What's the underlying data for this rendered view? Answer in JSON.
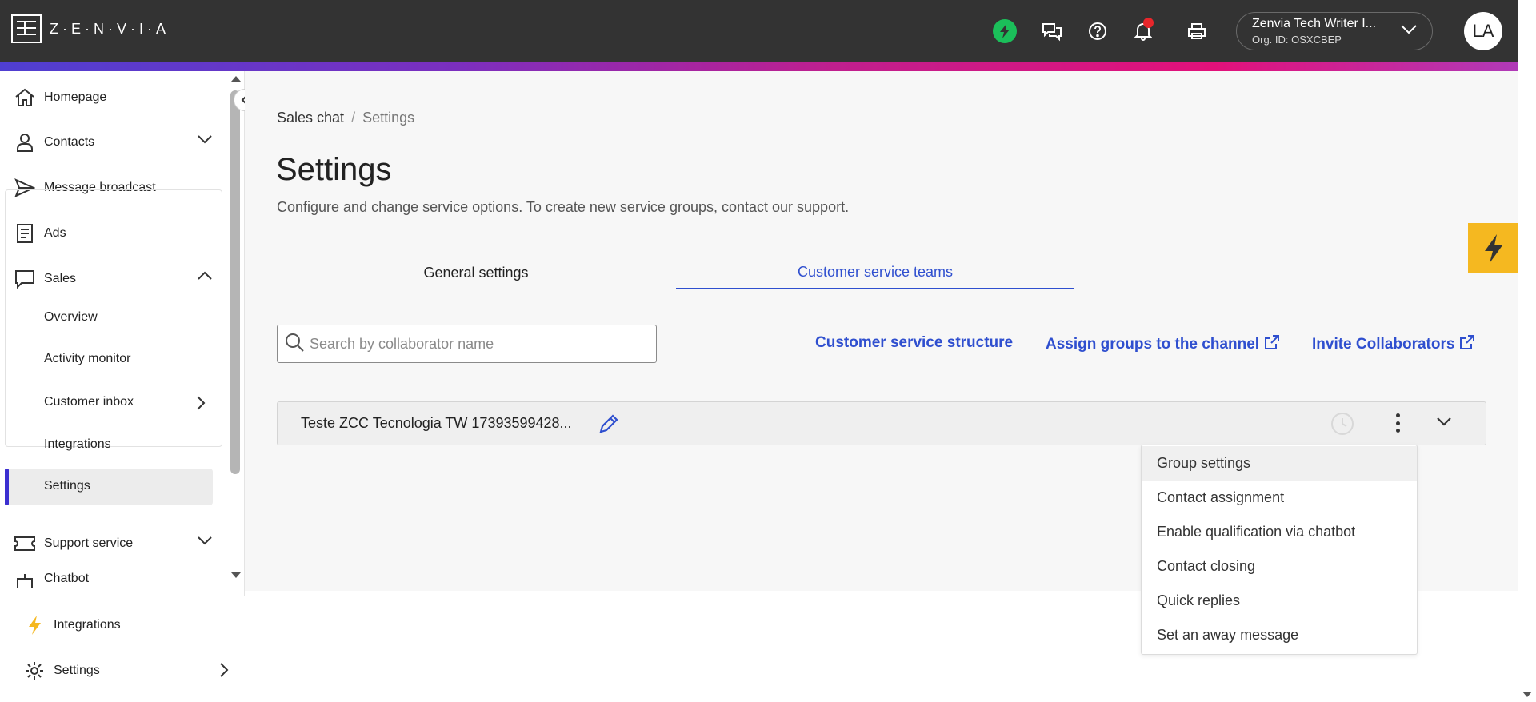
{
  "brand": {
    "logo_text": "Z·E·N·V·I·A"
  },
  "header": {
    "org_name": "Zenvia Tech Writer I...",
    "org_id": "Org. ID: OSXCBEP",
    "avatar_initials": "LA"
  },
  "sidebar": {
    "items": [
      {
        "label": "Homepage",
        "icon": "home-icon"
      },
      {
        "label": "Contacts",
        "icon": "user-icon"
      },
      {
        "label": "Message broadcast",
        "icon": "send-icon"
      },
      {
        "label": "Ads",
        "icon": "document-icon"
      },
      {
        "label": "Sales",
        "icon": "chat-icon"
      }
    ],
    "sales_sub": [
      "Overview",
      "Activity monitor",
      "Customer inbox",
      "Integrations",
      "Settings"
    ],
    "more_items": [
      {
        "label": "Support service",
        "icon": "ticket-icon"
      },
      {
        "label": "Chatbot",
        "icon": "bot-icon"
      }
    ],
    "footer": [
      {
        "label": "Integrations",
        "icon": "bolt-icon"
      },
      {
        "label": "Settings",
        "icon": "gear-icon"
      }
    ]
  },
  "main": {
    "breadcrumb": [
      "Sales chat",
      "Settings"
    ],
    "breadcrumb_sep": "/",
    "title": "Settings",
    "description": "Configure and change service options. To create new service groups, contact our support.",
    "tabs": [
      "General settings",
      "Customer service teams"
    ],
    "active_tab": "Customer service teams",
    "search_placeholder": "Search by collaborator name",
    "links": [
      "Customer service structure",
      "Assign groups to the channel",
      "Invite Collaborators"
    ],
    "group_name": "Teste ZCC Tecnologia TW 17393599428...",
    "menu": [
      "Group settings",
      "Contact assignment",
      "Enable qualification via chatbot",
      "Contact closing",
      "Quick replies",
      "Set an away message"
    ]
  },
  "colors": {
    "accent": "#2f4fcf",
    "topbar": "#333333",
    "active_bar": "#3b2fd0",
    "lightning_tab": "#f5b820",
    "status_green": "#1bbf5a",
    "notification": "#e8262b"
  }
}
